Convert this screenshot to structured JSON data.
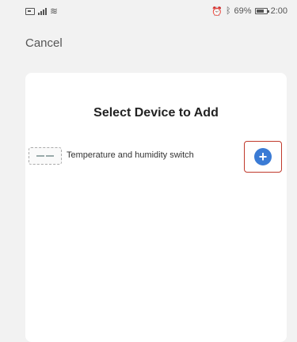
{
  "status_bar": {
    "battery_percent": "69%",
    "time": "2:00"
  },
  "header": {
    "cancel_label": "Cancel"
  },
  "dialog": {
    "title": "Select Device to Add",
    "devices": [
      {
        "name": "Temperature and humidity switch",
        "icon": "device-sensor-icon",
        "action_icon": "add-icon"
      }
    ]
  },
  "colors": {
    "accent": "#3a7bd5",
    "highlight": "#c0392b"
  }
}
